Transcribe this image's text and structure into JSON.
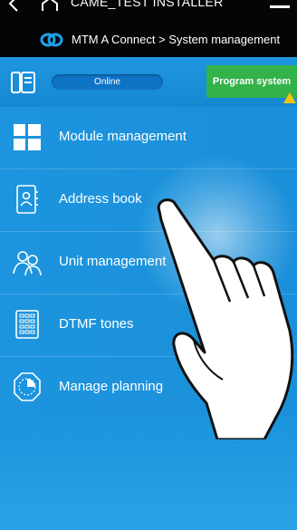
{
  "topbar": {
    "installer": "CAME_TEST INSTALLER",
    "breadcrumb": "MTM A Connect > System management"
  },
  "status": {
    "online_label": "Online",
    "program_button": "Program system"
  },
  "menu": {
    "items": [
      {
        "label": "Module management",
        "icon": "grid-icon"
      },
      {
        "label": "Address book",
        "icon": "contact-book-icon"
      },
      {
        "label": "Unit management",
        "icon": "users-icon"
      },
      {
        "label": "DTMF tones",
        "icon": "keypad-icon"
      },
      {
        "label": "Manage planning",
        "icon": "clock-icon"
      }
    ]
  },
  "colors": {
    "accent_blue": "#1a8fd8",
    "program_green": "#34b24a",
    "warning_yellow": "#f5c400"
  }
}
